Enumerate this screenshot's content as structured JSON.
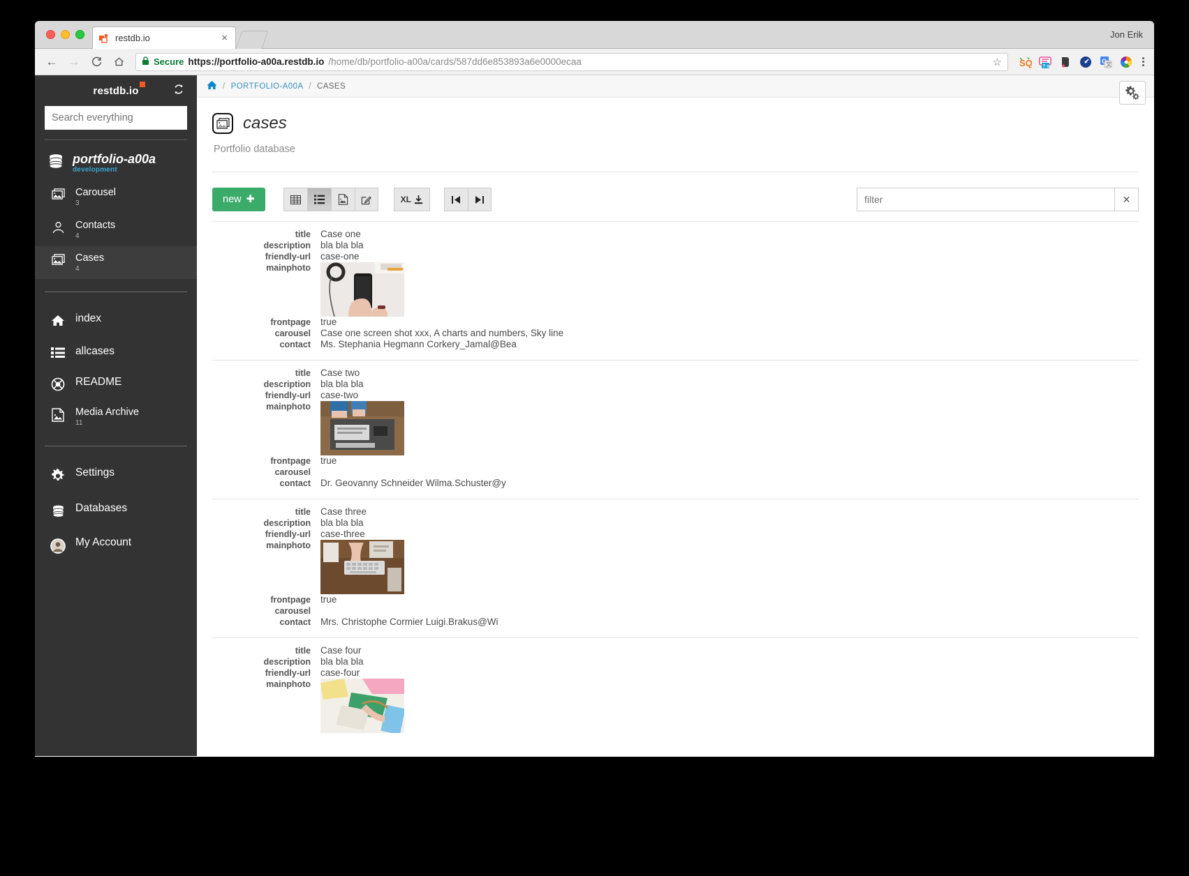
{
  "browser": {
    "tab_title": "restdb.io",
    "tab_favicon": "restdb-logo-icon",
    "close_label": "×",
    "user": "Jon Erik",
    "secure_label": "Secure",
    "url_main": "https://portfolio-a00a.restdb.io",
    "url_rest": "/home/db/portfolio-a00a/cards/587dd6e853893a6e0000ecaa",
    "back_label": "←",
    "forward_label": "→",
    "reload_label": "C",
    "home_label": "⌂",
    "star_label": "☆",
    "extensions": [
      "sq-icon",
      "pink-notes-icon",
      "evernote-icon",
      "speedtest-icon",
      "google-translate-icon",
      "color-wheel-icon"
    ]
  },
  "sidebar": {
    "logo": "restdb.io",
    "refresh_icon": "refresh-icon",
    "search_placeholder": "Search everything",
    "search_value": "",
    "database": {
      "name": "portfolio-a00a",
      "environment": "development",
      "icon": "database-icon"
    },
    "collections": [
      {
        "label": "Carousel",
        "count": "3",
        "icon": "images-icon",
        "active": false
      },
      {
        "label": "Contacts",
        "count": "4",
        "icon": "person-icon",
        "active": false
      },
      {
        "label": "Cases",
        "count": "4",
        "icon": "images-icon",
        "active": true
      }
    ],
    "pages": [
      {
        "label": "index",
        "icon": "home-icon"
      },
      {
        "label": "allcases",
        "icon": "list-icon"
      },
      {
        "label": "README",
        "icon": "lifebuoy-icon"
      },
      {
        "label": "Media Archive",
        "count": "11",
        "icon": "media-file-icon"
      }
    ],
    "bottom": [
      {
        "label": "Settings",
        "icon": "gear-icon"
      },
      {
        "label": "Databases",
        "icon": "database-icon"
      },
      {
        "label": "My Account",
        "icon": "avatar-icon"
      }
    ]
  },
  "breadcrumb": {
    "home_icon": "home-icon",
    "sep": "/",
    "db": "PORTFOLIO-A00A",
    "current": "CASES"
  },
  "header": {
    "icon": "images-icon",
    "title": "cases",
    "subtitle": "Portfolio database",
    "settings_icon": "gears-icon"
  },
  "toolbar": {
    "new_label": "new",
    "new_plus": "✚",
    "views": [
      {
        "name": "table-view",
        "icon": "▦",
        "active": false
      },
      {
        "name": "list-view",
        "icon": "≣",
        "active": true
      },
      {
        "name": "document-view",
        "icon": "⎘",
        "active": false
      },
      {
        "name": "edit-view",
        "icon": "✎",
        "active": false
      }
    ],
    "export_label": "XL",
    "export_icon": "⬇",
    "first_page_icon": "⏮",
    "last_page_icon": "⏭",
    "filter_placeholder": "filter",
    "filter_value": "",
    "filter_clear": "✕"
  },
  "records": [
    {
      "fields": [
        {
          "key": "title",
          "value": "Case one"
        },
        {
          "key": "description",
          "value": "bla bla bla"
        },
        {
          "key": "friendly-url",
          "value": "case-one"
        },
        {
          "key": "mainphoto",
          "value": "",
          "type": "photo",
          "photo": "phone-headphones-desk"
        },
        {
          "key": "frontpage",
          "value": "true"
        },
        {
          "key": "carousel",
          "value": "Case one screen shot xxx, A charts and numbers, Sky line"
        },
        {
          "key": "contact",
          "value": "Ms. Stephania Hegmann Corkery_Jamal@Bea"
        }
      ]
    },
    {
      "fields": [
        {
          "key": "title",
          "value": "Case two"
        },
        {
          "key": "description",
          "value": "bla bla bla"
        },
        {
          "key": "friendly-url",
          "value": "case-two"
        },
        {
          "key": "mainphoto",
          "value": "",
          "type": "photo",
          "photo": "desk-keyboard-topdown"
        },
        {
          "key": "frontpage",
          "value": "true"
        },
        {
          "key": "carousel",
          "value": ""
        },
        {
          "key": "contact",
          "value": "Dr. Geovanny Schneider Wilma.Schuster@y"
        }
      ]
    },
    {
      "fields": [
        {
          "key": "title",
          "value": "Case three"
        },
        {
          "key": "description",
          "value": "bla bla bla"
        },
        {
          "key": "friendly-url",
          "value": "case-three"
        },
        {
          "key": "mainphoto",
          "value": "",
          "type": "photo",
          "photo": "hands-keyboard-wood"
        },
        {
          "key": "frontpage",
          "value": "true"
        },
        {
          "key": "carousel",
          "value": ""
        },
        {
          "key": "contact",
          "value": "Mrs. Christophe Cormier Luigi.Brakus@Wi"
        }
      ]
    },
    {
      "fields": [
        {
          "key": "title",
          "value": "Case four"
        },
        {
          "key": "description",
          "value": "bla bla bla"
        },
        {
          "key": "friendly-url",
          "value": "case-four"
        },
        {
          "key": "mainphoto",
          "value": "",
          "type": "photo",
          "photo": "colored-paper-craft"
        }
      ]
    }
  ],
  "colors": {
    "sidebar_bg": "#333333",
    "sidebar_active": "#3d3d3d",
    "accent_green": "#3aab68",
    "accent_orange": "#f15a24",
    "link_blue": "#3a8fc0",
    "env_blue": "#3aa7d4"
  }
}
